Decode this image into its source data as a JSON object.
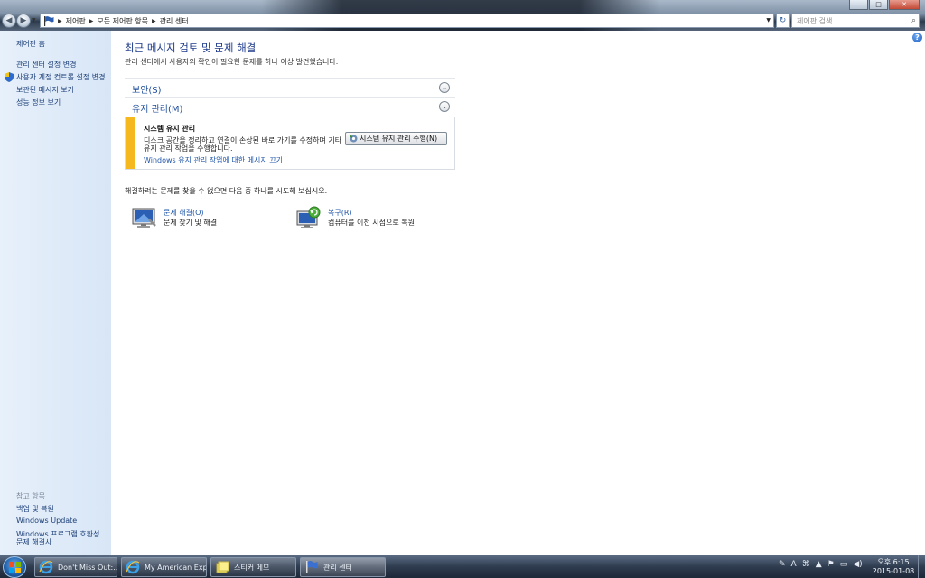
{
  "window": {
    "controls": {
      "minimize": "–",
      "maximize": "□",
      "close": "✕"
    }
  },
  "address_bar": {
    "crumbs": [
      "제어판",
      "모든 제어판 항목",
      "관리 센터"
    ],
    "search_placeholder": "제어판 검색"
  },
  "sidebar": {
    "home": "제어판 홈",
    "links": [
      {
        "label": "관리 센터 설정 변경",
        "icon": "none"
      },
      {
        "label": "사용자 계정 컨트롤 설정 변경",
        "icon": "uac-shield-icon"
      },
      {
        "label": "보관된 메시지 보기",
        "icon": "none"
      },
      {
        "label": "성능 정보 보기",
        "icon": "none"
      }
    ],
    "see_also_header": "참고 항목",
    "see_also": [
      "백업 및 복원",
      "Windows Update",
      "Windows 프로그램 호환성",
      "문제 해결사"
    ]
  },
  "main": {
    "title": "최근 메시지 검토 및 문제 해결",
    "subtitle": "관리 센터에서 사용자의 확인이 필요한 문제를 하나 이상 발견했습니다.",
    "sections": [
      {
        "label": "보안(S)",
        "expanded": false
      },
      {
        "label": "유지 관리(M)",
        "expanded": true
      }
    ],
    "message": {
      "title": "시스템 유지 관리",
      "desc_line1": "디스크 공간을 정리하고 연결이 손상된 바로 가기를 수정하며 기타",
      "desc_line2": "유지 관리 작업을 수행합니다.",
      "link": "Windows 유지 관리 작업에 대한 메시지 끄기",
      "button": "시스템 유지 관리 수행(N)",
      "severity_color": "#f5b81f"
    },
    "hint": "해결하려는 문제를 찾을 수 없으면 다음 중 하나를 시도해 보십시오.",
    "tools": [
      {
        "name": "문제 해결(O)",
        "desc": "문제 찾기 및 해결",
        "icon": "troubleshoot-icon"
      },
      {
        "name": "복구(R)",
        "desc": "컴퓨터를 이전 시점으로 복원",
        "icon": "recovery-icon"
      }
    ]
  },
  "taskbar": {
    "items": [
      {
        "label": "Don't Miss Out:...",
        "icon": "ie-icon",
        "active": false
      },
      {
        "label": "My American Exp...",
        "icon": "ie-icon",
        "active": false
      },
      {
        "label": "스티커 메모",
        "icon": "sticky-notes-icon",
        "active": false
      },
      {
        "label": "관리 센터",
        "icon": "action-center-flag-icon",
        "active": true
      }
    ],
    "tray_lang": "A",
    "clock_time": "오후 6:15",
    "clock_date": "2015-01-08"
  }
}
